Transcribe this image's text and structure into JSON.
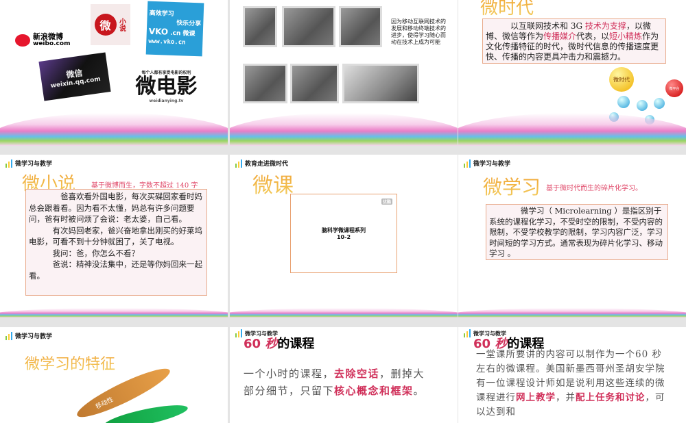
{
  "slide1": {
    "weibo_name": "新浪微博",
    "weibo_url": "weibo.com",
    "weixiaoshuo_a": "微",
    "weixiaoshuo_b": "小说",
    "vko_line1": "高效学习",
    "vko_line2": "快乐分享",
    "vko_brand": "VKO",
    "vko_cn": ".cn 微课",
    "vko_url": "www.vko.cn",
    "weixin_name": "微信",
    "weixin_url": "weixin.qq.com",
    "movie_tagline": "每个人都有享受电影的权利",
    "movie_title": "微电影",
    "movie_url": "weidianying.tv"
  },
  "slide2": {
    "caption": "因为移动互联网技术的发展和移动终端技术的进步，使得学习随心而动在技术上成为可能"
  },
  "slide3": {
    "title": "微时代",
    "p1": "以互联网技术和 3G ",
    "h1": "技术为支撑",
    "p2": "，以微博、微信等作为",
    "h2": "传播媒介",
    "p3": "代表，以",
    "h3": "短小精炼",
    "p4": "作为文化传播特征的时代，微时代信息的传播速度更快、传播的内容更具冲击力和震撼力。",
    "ball_main": "微时代",
    "ball_red": "微平台"
  },
  "slide4": {
    "header": "微学习与教学",
    "title": "微小说",
    "subtitle": "基于微博而生，字数不超过 140 字",
    "paragraphs": [
      "爸喜欢看外国电影，每次买碟回家看时妈总会跟着看。因为看不太懂，妈总有许多问题要问，爸有时被问烦了会说：老太婆，自己看。",
      "有次妈回老家，爸兴奋地拿出刚买的好莱坞电影，可看不到十分钟就困了，关了电视。",
      "我问：爸，你怎么不看？",
      "爸说：精神没法集中，还是等你妈回来一起看。"
    ]
  },
  "slide5": {
    "header": "教育走进微时代",
    "title": "微课",
    "video_title": "脑科学微课程系列",
    "video_sub": "10-2",
    "video_badge": "优酷"
  },
  "slide6": {
    "header": "微学习与教学",
    "title": "微学习",
    "subtitle": "基于微时代而生的碎片化学习。",
    "body": "微学习（ Microlearning ）是指区别于系统的课程化学习，不受时空的限制，不受内容的限制，不受学校教学的限制，学习内容广泛，学习时间短的学习方式。通常表现为碎片化学习、移动学习 。"
  },
  "slide7": {
    "header": "微学习与教学",
    "title": "微学习的特征",
    "petal": "移动性"
  },
  "slide8": {
    "header": "微学习与教学",
    "title_num": "60",
    "title_sec": "秒",
    "title_rest": "的课程",
    "t1": "一个小时的课程，",
    "h1": "去除空话",
    "t2": "，删掉大部分细节，只留下",
    "h2": "核心概念和框架",
    "t3": "。"
  },
  "slide9": {
    "header": "微学习与教学",
    "title_num": "60",
    "title_sec": "秒",
    "title_rest": "的课程",
    "t1": "一堂课所要讲的内容可以制作为一个60 秒左右的微课程。美国新墨西哥州圣胡安学院有一位课程设计师如是说利用这些连续的微课程进行",
    "h1": "网上教学",
    "t2": "，并",
    "h2": "配上任务和讨论",
    "t3": "，可以达到和"
  }
}
